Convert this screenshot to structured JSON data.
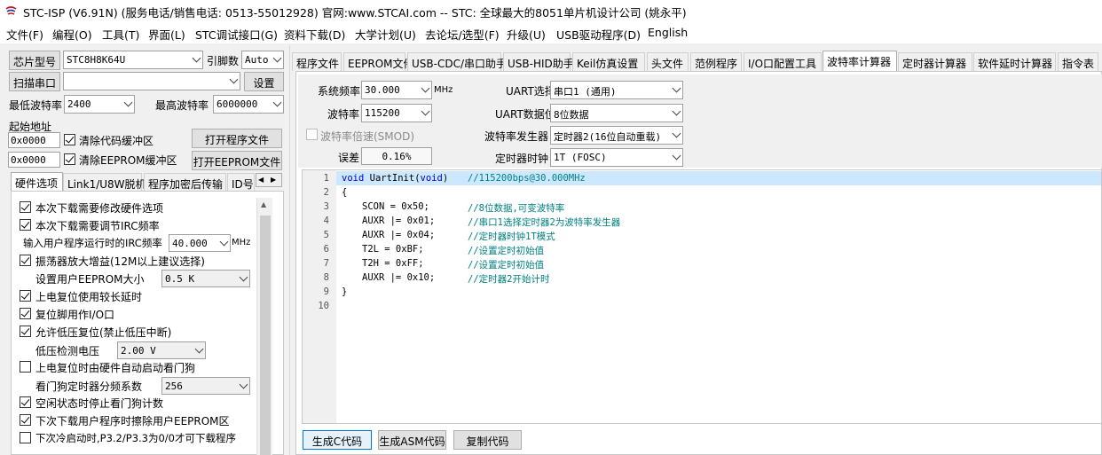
{
  "title": "STC-ISP (V6.91N) (服务电话/销售电话: 0513-55012928) 官网:www.STCAI.com  -- STC: 全球最大的8051单片机设计公司 (姚永平)",
  "menu": [
    "文件(F)",
    "编程(O)",
    "工具(T)",
    "界面(L)",
    "STC调试接口(G)",
    "资料下载(D)",
    "大学计划(U)",
    "去论坛/选型(F)",
    "升级(U)",
    "USB驱动程序(D)",
    "English"
  ],
  "left": {
    "chip_model_label": "芯片型号",
    "chip_model_value": "STC8H8K64U",
    "pin_count_label": "引脚数",
    "pin_count_value": "Auto",
    "scan_port_label": "扫描串口",
    "scan_port_value": "",
    "settings_button": "设置",
    "min_baud_label": "最低波特率",
    "min_baud_value": "2400",
    "max_baud_label": "最高波特率",
    "max_baud_value": "6000000",
    "start_addr_label": "起始地址",
    "addr1": "0x0000",
    "clear_code_label": "清除代码缓冲区",
    "open_program_button": "打开程序文件",
    "addr2": "0x0000",
    "clear_eeprom_label": "清除EEPROM缓冲区",
    "open_eeprom_button": "打开EEPROM文件",
    "tabs": [
      "硬件选项",
      "Link1/U8W脱机",
      "程序加密后传输",
      "ID号"
    ],
    "options": {
      "opt1": "本次下载需要修改硬件选项",
      "opt2": "本次下载需要调节IRC频率",
      "irc_label": "输入用户程序运行时的IRC频率",
      "irc_value": "40.000",
      "irc_unit": "MHz",
      "opt3": "振荡器放大增益(12M以上建议选择)",
      "eeprom_size_label": "设置用户EEPROM大小",
      "eeprom_size_value": "0.5 K",
      "opt4": "上电复位使用较长延时",
      "opt5": "复位脚用作I/O口",
      "opt6": "允许低压复位(禁止低压中断)",
      "lvd_label": "低压检测电压",
      "lvd_value": "2.00 V",
      "opt7": "上电复位时由硬件自动启动看门狗",
      "wdt_label": "看门狗定时器分频系数",
      "wdt_value": "256",
      "opt8": "空闲状态时停止看门狗计数",
      "opt9": "下次下载用户程序时擦除用户EEPROM区",
      "opt10": "下次冷启动时,P3.2/P3.3为0/0才可下载程序"
    }
  },
  "right_tabs": [
    "程序文件",
    "EEPROM文件",
    "USB-CDC/串口助手",
    "USB-HID助手",
    "Keil仿真设置",
    "头文件",
    "范例程序",
    "I/O口配置工具",
    "波特率计算器",
    "定时器计算器",
    "软件延时计算器",
    "指令表"
  ],
  "baud": {
    "sys_freq_label": "系统频率",
    "sys_freq_value": "30.000",
    "mhz": "MHz",
    "baud_label": "波特率",
    "baud_value": "115200",
    "double_label": "波特率倍速(SMOD)",
    "error_label": "误差",
    "error_value": "0.16%",
    "uart_sel_label": "UART选择",
    "uart_sel_value": "串口1 (通用)",
    "uart_bits_label": "UART数据位",
    "uart_bits_value": "8位数据",
    "gen_label": "波特率发生器",
    "gen_value": "定时器2(16位自动重载)",
    "clock_label": "定时器时钟",
    "clock_value": "1T  (FOSC)"
  },
  "code": {
    "line_numbers": [
      "1",
      "2",
      "3",
      "4",
      "5",
      "6",
      "7",
      "8",
      "9",
      "10"
    ],
    "l1_kw1": "void",
    "l1_fn": " UartInit(",
    "l1_kw2": "void",
    "l1_close": ")",
    "l1_cm": "//115200bps@30.000MHz",
    "l2": "{",
    "l3_code": "SCON = 0x50;",
    "l3_cm": "//8位数据,可变波特率",
    "l4_code": "AUXR |= 0x01;",
    "l4_cm": "//串口1选择定时器2为波特率发生器",
    "l5_code": "AUXR |= 0x04;",
    "l5_cm": "//定时器时钟1T模式",
    "l6_code": "T2L = 0xBF;",
    "l6_cm": "//设置定时初始值",
    "l7_code": "T2H = 0xFF;",
    "l7_cm": "//设置定时初始值",
    "l8_code": "AUXR |= 0x10;",
    "l8_cm": "//定时器2开始计时",
    "l9": "}"
  },
  "buttons": {
    "gen_code": "生成C代码",
    "gen_asm": "生成ASM代码",
    "copy_code": "复制代码"
  },
  "colors": {
    "accent": "#0078d7",
    "highlight_line": "#cce8ff",
    "comment": "#008080",
    "keyword": "#0000c8"
  }
}
